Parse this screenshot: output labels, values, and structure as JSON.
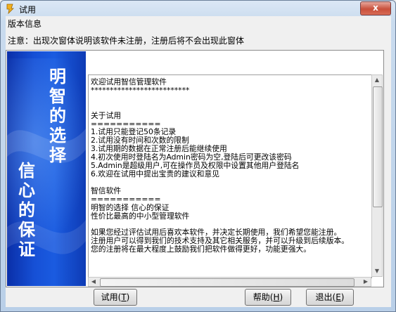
{
  "window": {
    "title": "试用",
    "close_glyph": "x"
  },
  "menubar": {
    "item": "版本信息"
  },
  "notice": "注意：出现次窗体说明该软件未注册，注册后将不会出现此窗体",
  "side_panel": {
    "text_top": "明智的选择",
    "text_bottom": "信心的保证"
  },
  "document": {
    "text": "欢迎试用智信管理软件\n**************************\n\n\n关于试用\n===========\n1.试用只能登记50条记录\n2.试用没有时间和次数的限制\n3.试用期的数据在正常注册后能继续使用\n4.初次使用时登陆名为Admin密码为空,登陆后可更改该密码\n5.Admin是超级用户,可在操作员及权限中设置其他用户登陆名\n6.欢迎在试用中提出宝贵的建议和意见\n\n智信软件\n===========\n明智的选择 信心的保证\n性价比最高的中小型管理软件\n\n如果您经过评估试用后喜欢本软件，并决定长期使用，我们希望您能注册。\n注册用户可以得到我们的技术支持及其它相关服务，并可以升级到后续版本。\n您的注册将在最大程度上鼓励我们把软件做得更好，功能更强大。"
  },
  "buttons": {
    "trial": {
      "label": "试用(",
      "key": "T",
      "end": ")"
    },
    "help": {
      "label": "帮助(",
      "key": "H",
      "end": ")"
    },
    "exit": {
      "label": "退出(",
      "key": "E",
      "end": ")"
    }
  },
  "icons": {
    "app": "app-icon",
    "close": "close-icon",
    "scroll_up": "scroll-up-icon",
    "scroll_down": "scroll-down-icon",
    "scroll_left": "scroll-left-icon",
    "scroll_right": "scroll-right-icon"
  },
  "colors": {
    "side_panel_blue": "#1650d6",
    "close_red": "#c9503b",
    "title_bar": "#c9dbee"
  }
}
